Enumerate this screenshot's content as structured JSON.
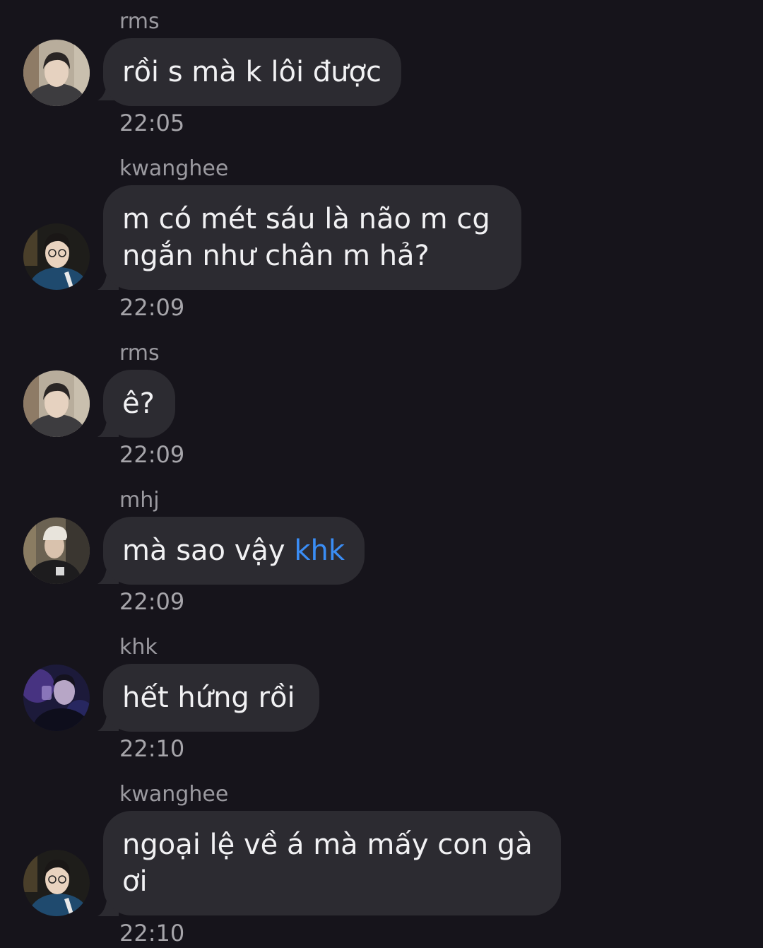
{
  "messages": [
    {
      "sender": "rms",
      "text": "rồi s mà k lôi được",
      "time": "22:05",
      "avatar": "avatar-rms"
    },
    {
      "sender": "kwanghee",
      "line1": "m có mét sáu là não m cg",
      "line2": "ngắn như chân m hả?",
      "time": "22:09",
      "avatar": "avatar-kwanghee"
    },
    {
      "sender": "rms",
      "text": "ê?",
      "time": "22:09",
      "avatar": "avatar-rms"
    },
    {
      "sender": "mhj",
      "text": "mà sao vậy ",
      "mention": "khk",
      "time": "22:09",
      "avatar": "avatar-mhj"
    },
    {
      "sender": "khk",
      "text": "hết hứng rồi",
      "time": "22:10",
      "avatar": "avatar-khk"
    },
    {
      "sender": "kwanghee",
      "line1": "ngoại lệ về á mà mấy con gà",
      "line2": "ơi",
      "time": "22:10",
      "avatar": "avatar-kwanghee"
    }
  ],
  "colors": {
    "background": "#16141b",
    "bubble": "#2c2b31",
    "text": "#f1f1f3",
    "meta": "#9b9aa0",
    "mention": "#3a8df5"
  }
}
